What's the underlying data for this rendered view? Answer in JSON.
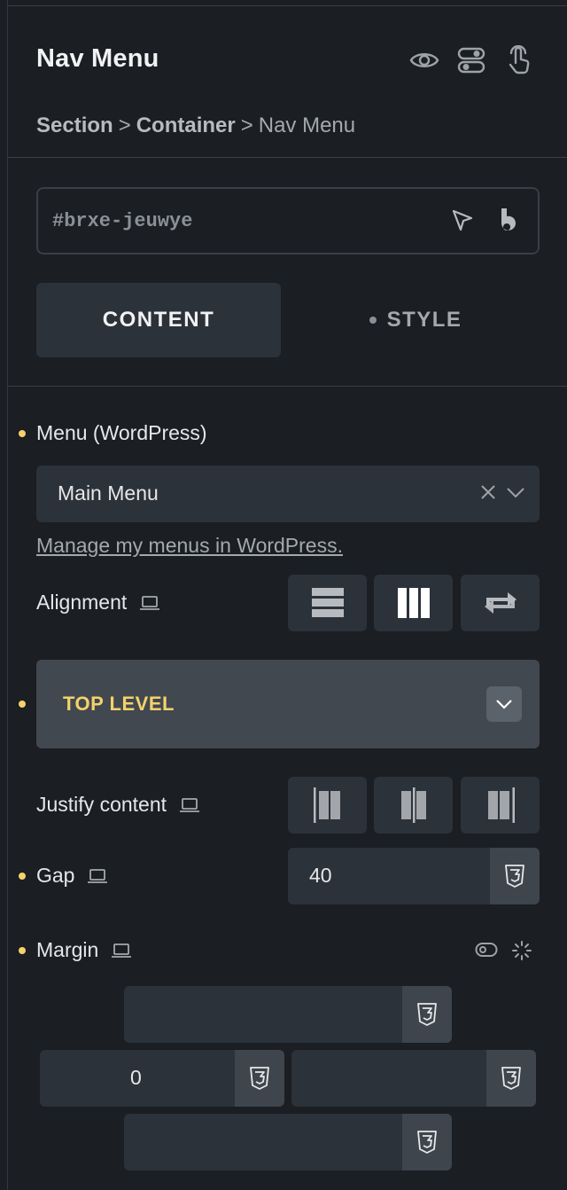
{
  "header": {
    "title": "Nav Menu",
    "icons": [
      "eye-icon",
      "toggle-icon",
      "pointer-hand-icon"
    ]
  },
  "breadcrumb": {
    "items": [
      "Section",
      "Container",
      "Nav Menu"
    ],
    "separator": ">"
  },
  "element_id": {
    "value": "",
    "placeholder": "#brxe-jeuwye",
    "icons": [
      "cursor-arrow-icon",
      "bricks-b-icon"
    ]
  },
  "tabs": [
    {
      "label": "CONTENT",
      "active": true
    },
    {
      "label": "STYLE",
      "active": false
    }
  ],
  "menu": {
    "label": "Menu (WordPress)",
    "selected": "Main Menu",
    "manage_link": "Manage my menus in WordPress."
  },
  "alignment": {
    "label": "Alignment",
    "options": [
      "rows-icon",
      "columns-icon",
      "swap-icon"
    ]
  },
  "top_level": {
    "label": "TOP LEVEL",
    "expanded": true
  },
  "justify_content": {
    "label": "Justify content",
    "options": [
      "justify-start-icon",
      "justify-center-icon",
      "justify-end-icon"
    ]
  },
  "gap": {
    "label": "Gap",
    "value": "40"
  },
  "margin": {
    "label": "Margin",
    "top": "",
    "left": "0",
    "right": "",
    "bottom": ""
  },
  "colors": {
    "background": "#1b1e22",
    "control": "#2c323a",
    "accent_yellow": "#f5d26a",
    "accordion": "#414850"
  }
}
